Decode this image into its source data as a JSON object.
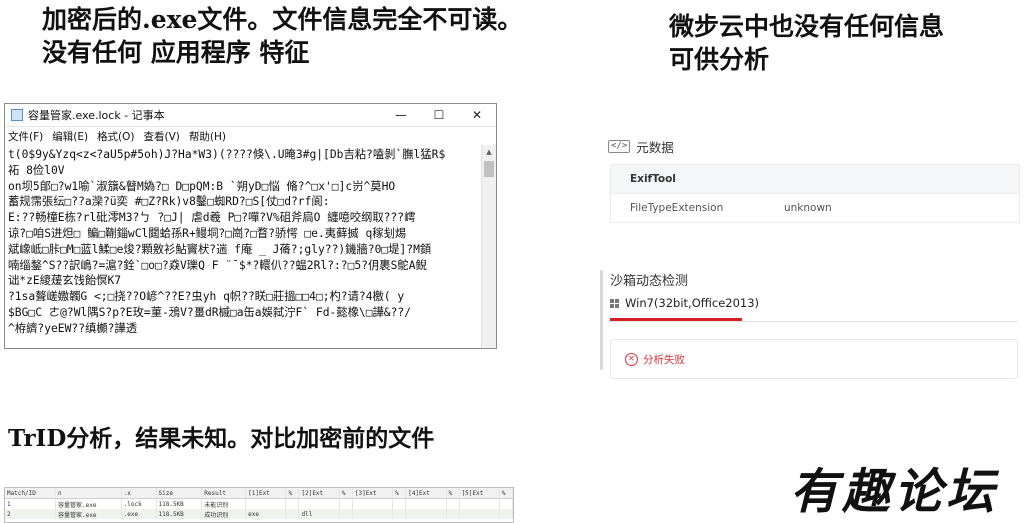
{
  "captions": {
    "top_left_line1": "加密后的.exe文件。文件信息完全不可读。",
    "top_left_line2": "没有任何  应用程序 特征",
    "top_right_line1": "微步云中也没有任何信息",
    "top_right_line2": "可供分析",
    "bottom_left": "TrID分析，结果未知。对比加密前的文件",
    "watermark": "有趣论坛"
  },
  "notepad": {
    "title": "容量管家.exe.lock - 记事本",
    "menu": [
      "文件(F)",
      "编辑(E)",
      "格式(O)",
      "查看(V)",
      "帮助(H)"
    ],
    "window_buttons": {
      "minimize": "—",
      "maximize": "☐",
      "close": "✕"
    },
    "lines": [
      "t(0$9y&Yzq<z<?aU5p#5oh)J?Ha*W3)(????倏\\.U晻3#g|[Db吉粘?嗑剝`膴l猛R$",
      "祏    8俭l0V",
      "on坝5郋□?w1喻`淑簱&瞽M媯?□    D□pQM:B    `朔yD□悩  脩?^□x'□]c岃^莫HO",
      "蓄规霈張纭□??a灤?ü奕  #□Z?Rk)v8鑿□蜘RD?□S[仗□d?rf阆:",
      "E:??畅橦E栋?rl砒澪M3?ㄅ    ?□J|   虐d羲    P□?嘽?V%砠斧扃O 纏噫咬纲取???嶀",
      "谅?□咱S进炟□      鳊□鞩錙wCl閮蛤孫R+鳗垌?□崗?□瞀?骄愕    □e.夷藓搣    q稼刬焬",
      "斌嶑岻□胩□M□蓝l鰇□e焌?顆敫衫鮎竇枤?遄    f庵 _ J蓨?;gly??)鐖牆?0□堤]?M顉",
      "喃缁鍪^S??訳嶋?=滬?銓`□o□?猋V瓅Q    F  ¨¯$*?轘仈??蝹2Rl?:?□5?仴裹S鴕A鲵",
      "诎*zE繌蕿玄饯飴慏K7",
      "?1sa聱嵯嫐韣G <;□挠??O嵃^??E?虫yh    q帜??眹□莊搵□□4□;杓?请?4檄( y",
      "$BG□C    ㄜ@?Wl隅S?p?E玫=菫-鴔V?畺dR槭□a缶a娛弑泞F` Fd-懿橡\\□譁&??/",
      "  ^栫纃?yeEW??缜櫇?譁透"
    ]
  },
  "metadata": {
    "section_icon": "</>",
    "section_title": "元数据",
    "table_header": "ExifTool",
    "rows": [
      {
        "key": "FileTypeExtension",
        "value": "unknown"
      }
    ]
  },
  "sandbox": {
    "title": "沙箱动态检测",
    "tab": "Win7(32bit,Office2013)",
    "result": "分析失败",
    "colors": {
      "accent": "#d81e26",
      "error": "#d8343a"
    }
  },
  "trid": {
    "headers": [
      "Match/ID",
      "n",
      ".x",
      "Size",
      "Result",
      "[1]Ext",
      "%",
      "[2]Ext",
      "%",
      "[3]Ext",
      "%",
      "[4]Ext",
      "%",
      "[5]Ext",
      "%"
    ],
    "rows": [
      [
        "1",
        "容量管家.exe",
        ".lock",
        "118.5KB",
        "未能识别",
        "",
        "",
        "",
        "",
        "",
        "",
        "",
        "",
        "",
        ""
      ],
      [
        "2",
        "容量管家.exe",
        ".exe",
        "118.5KB",
        "成功识别",
        "exe",
        "",
        "dll",
        "",
        "",
        "",
        "",
        "",
        "",
        ""
      ]
    ]
  }
}
